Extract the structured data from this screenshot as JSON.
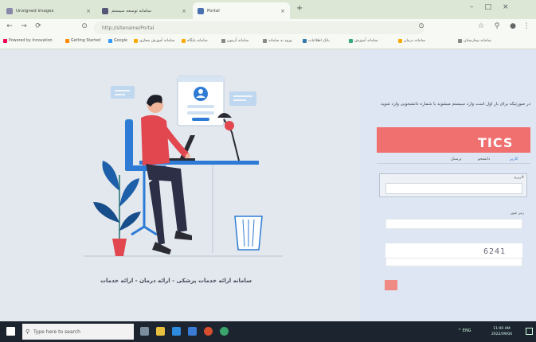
{
  "browser": {
    "tabs": [
      {
        "label": "Unsigned images",
        "active": false
      },
      {
        "label": "سامانه توسعه سیستم",
        "active": false
      },
      {
        "label": "Portal",
        "active": true
      }
    ],
    "new_tab": "+",
    "address": "http://sitename/Portal",
    "bookmarks": [
      "Powered by Innovation",
      "Getting Started",
      "Google",
      "سامانه آموزش مجازی",
      "سامانه پایگاه",
      "سامانه آزمون",
      "ورود به سامانه",
      "بانک اطلاعات",
      "سامانه آموزش",
      "سامانه درمان",
      "سامانه بیمارستان"
    ]
  },
  "panel": {
    "instructions": "در صورتیکه برای بار اول است وارد سیستم میشوید با شماره دانشجویی وارد شوید",
    "logo": "TICS",
    "tabs": [
      "کاربر",
      "دانشجو",
      "پرسنل"
    ],
    "username_label": "کاربری",
    "password_label": "رمز عبور",
    "captcha": "6241",
    "submit": ""
  },
  "caption": "سامانه ارائه خدمات پزشکی - ارائه درمان - ارائه خدمات",
  "taskbar": {
    "search_placeholder": "Type here to search",
    "tray": "^ ENG",
    "time": "11:00 AM",
    "date": "2022/09/04"
  },
  "colors": {
    "accent": "#f07070",
    "panel_bg": "#dde6f2",
    "taskbar": "#1c2430"
  }
}
